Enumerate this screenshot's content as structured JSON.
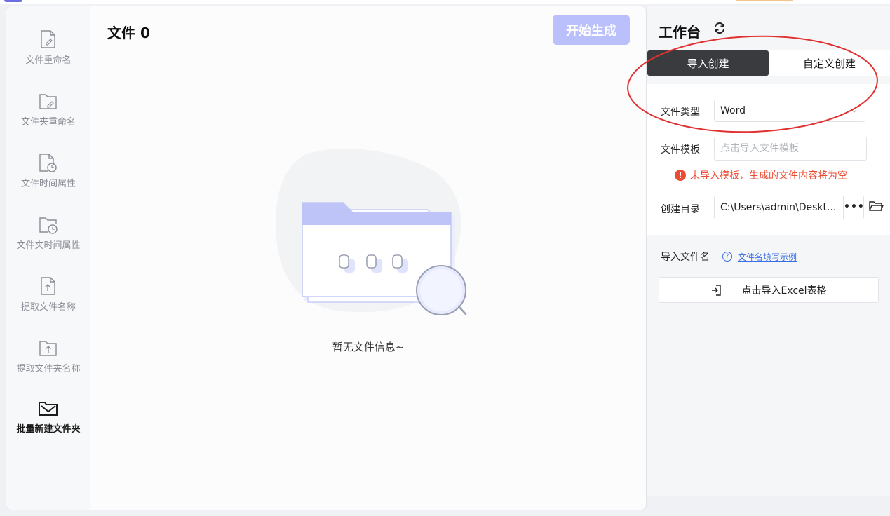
{
  "sidebar": {
    "items": [
      {
        "label": "文件重命名",
        "icon": "file-edit-icon"
      },
      {
        "label": "文件夹重命名",
        "icon": "folder-edit-icon"
      },
      {
        "label": "文件时间属性",
        "icon": "file-clock-icon"
      },
      {
        "label": "文件夹时间属性",
        "icon": "folder-clock-icon"
      },
      {
        "label": "提取文件名称",
        "icon": "file-upload-icon"
      },
      {
        "label": "提取文件夹名称",
        "icon": "folder-upload-icon"
      },
      {
        "label": "批量新建文件夹",
        "icon": "folder-mail-icon",
        "active": true
      }
    ]
  },
  "content": {
    "title": "文件 0",
    "start_button": "开始生成",
    "empty_text": "暂无文件信息~"
  },
  "panel": {
    "title": "工作台",
    "tabs": [
      {
        "label": "导入创建",
        "active": true
      },
      {
        "label": "自定义创建",
        "active": false
      }
    ],
    "file_type_label": "文件类型",
    "file_type_value": "Word",
    "template_label": "文件模板",
    "template_placeholder": "点击导入文件模板",
    "warning": "未导入模板，生成的文件内容将为空",
    "dir_label": "创建目录",
    "dir_value": "C:\\Users\\admin\\Deskt...",
    "dir_more": "•••",
    "import_name_label": "导入文件名",
    "example_link": "文件名填写示例",
    "excel_button": "点击导入Excel表格"
  },
  "colors": {
    "accent": "#b9c0fb",
    "active_tab": "#3a3b3e",
    "warning": "#ec4b34",
    "link": "#3a6de8",
    "annotation": "#e03030"
  }
}
